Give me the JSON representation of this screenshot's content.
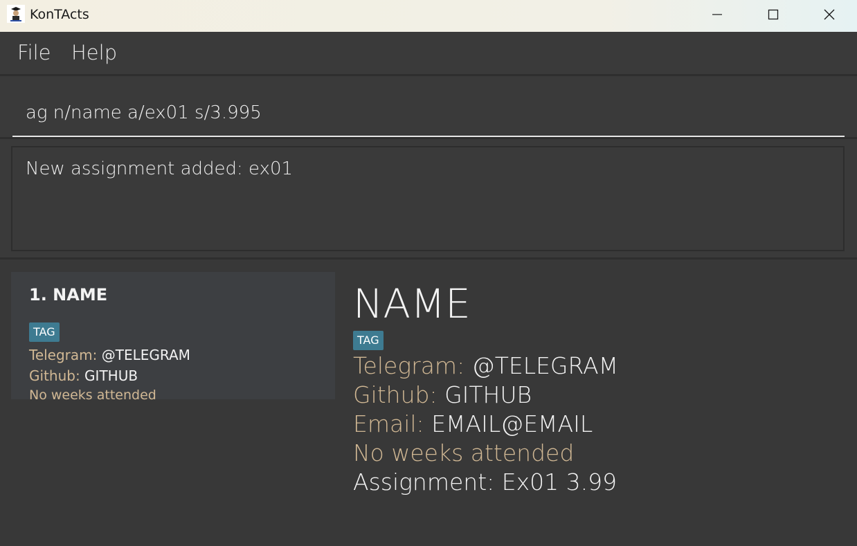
{
  "window": {
    "title": "KonTActs",
    "controls": [
      "minimize-icon",
      "maximize-icon",
      "close-icon"
    ]
  },
  "menu": {
    "items": [
      "File",
      "Help"
    ]
  },
  "command": {
    "value": "ag n/name a/ex01 s/3.995"
  },
  "result": {
    "message": "New assignment added: ex01"
  },
  "list": {
    "cards": [
      {
        "index_name": "1. NAME",
        "tag": "TAG",
        "telegram_label": "Telegram:",
        "telegram_value": "@TELEGRAM",
        "github_label": "Github:",
        "github_value": "GITHUB",
        "attendance": "No weeks attended"
      }
    ]
  },
  "detail": {
    "name": "NAME",
    "tag": "TAG",
    "telegram_label": "Telegram:",
    "telegram_value": "@TELEGRAM",
    "github_label": "Github:",
    "github_value": "GITHUB",
    "email_label": "Email:",
    "email_value": "EMAIL@EMAIL",
    "attendance": "No weeks attended",
    "assignment": "Assignment: Ex01 3.99"
  },
  "colors": {
    "background": "#383838",
    "label": "#d1b894",
    "tag": "#3e7b91",
    "card": "#3d3f42"
  }
}
